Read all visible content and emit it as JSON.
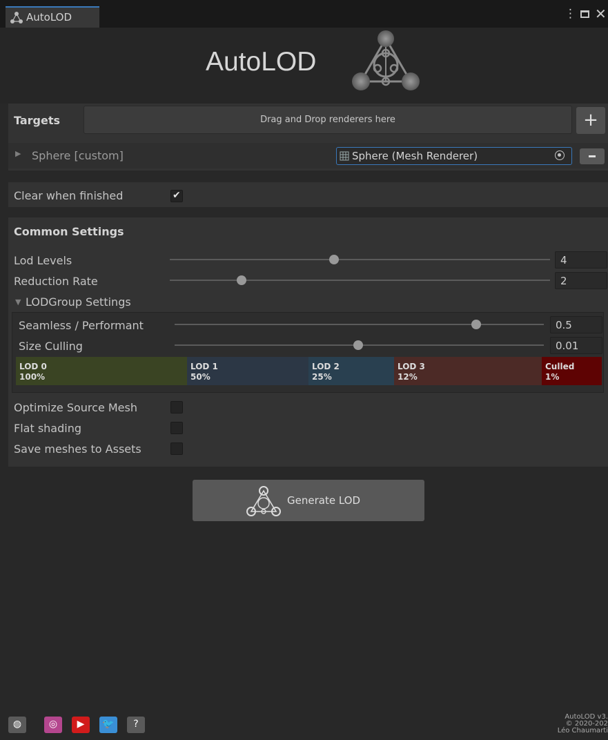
{
  "window": {
    "tab_title": "AutoLOD",
    "menu_glyph": "⋮",
    "close_glyph": "✕"
  },
  "banner": {
    "title": "AutoLOD",
    "logo_icon": "autolod-logo-icon"
  },
  "targets": {
    "label": "Targets",
    "drop_text": "Drag and Drop renderers here",
    "add_label": "+",
    "items": [
      {
        "name": "Sphere [custom]",
        "object_field": "Sphere (Mesh Renderer)"
      }
    ]
  },
  "clear_when_finished": {
    "label": "Clear when finished",
    "checked": true,
    "mark": "✔"
  },
  "common_settings": {
    "title": "Common Settings",
    "lod_levels": {
      "label": "Lod Levels",
      "value": "4"
    },
    "reduction_rate": {
      "label": "Reduction Rate",
      "value": "2"
    },
    "lodgroup": {
      "label": "LODGroup Settings",
      "expanded": true,
      "seamless": {
        "label": "Seamless / Performant",
        "value": "0.5"
      },
      "size_culling": {
        "label": "Size Culling",
        "value": "0.01"
      },
      "lods": [
        {
          "name": "LOD 0",
          "percent": "100%",
          "color": "#3a4423"
        },
        {
          "name": "LOD 1",
          "percent": "50%",
          "color": "#2c3745"
        },
        {
          "name": "LOD 2",
          "percent": "25%",
          "color": "#294050"
        },
        {
          "name": "LOD 3",
          "percent": "12%",
          "color": "#4c2a26"
        },
        {
          "name": "Culled",
          "percent": "1%",
          "color": "#5e0303"
        }
      ]
    },
    "optimize_source_mesh": {
      "label": "Optimize Source Mesh",
      "checked": false
    },
    "flat_shading": {
      "label": "Flat shading",
      "checked": false
    },
    "save_meshes": {
      "label": "Save meshes to Assets",
      "checked": false
    }
  },
  "generate": {
    "label": "Generate LOD"
  },
  "footer": {
    "links": [
      {
        "icon": "globe-icon",
        "glyph": "◍",
        "color": "#5a5a5a"
      },
      {
        "icon": "instagram-icon",
        "glyph": "◎",
        "color": "#b4468e"
      },
      {
        "icon": "youtube-icon",
        "glyph": "▶",
        "color": "#d11b1b"
      },
      {
        "icon": "twitter-icon",
        "glyph": "🐦",
        "color": "#3a8fd6"
      },
      {
        "icon": "help-icon",
        "glyph": "?",
        "color": "#5a5a5a"
      }
    ],
    "credit_line1": "AutoLOD v3.",
    "credit_line2": "© 2020-202",
    "credit_line3": "Léo Chaumarti"
  }
}
